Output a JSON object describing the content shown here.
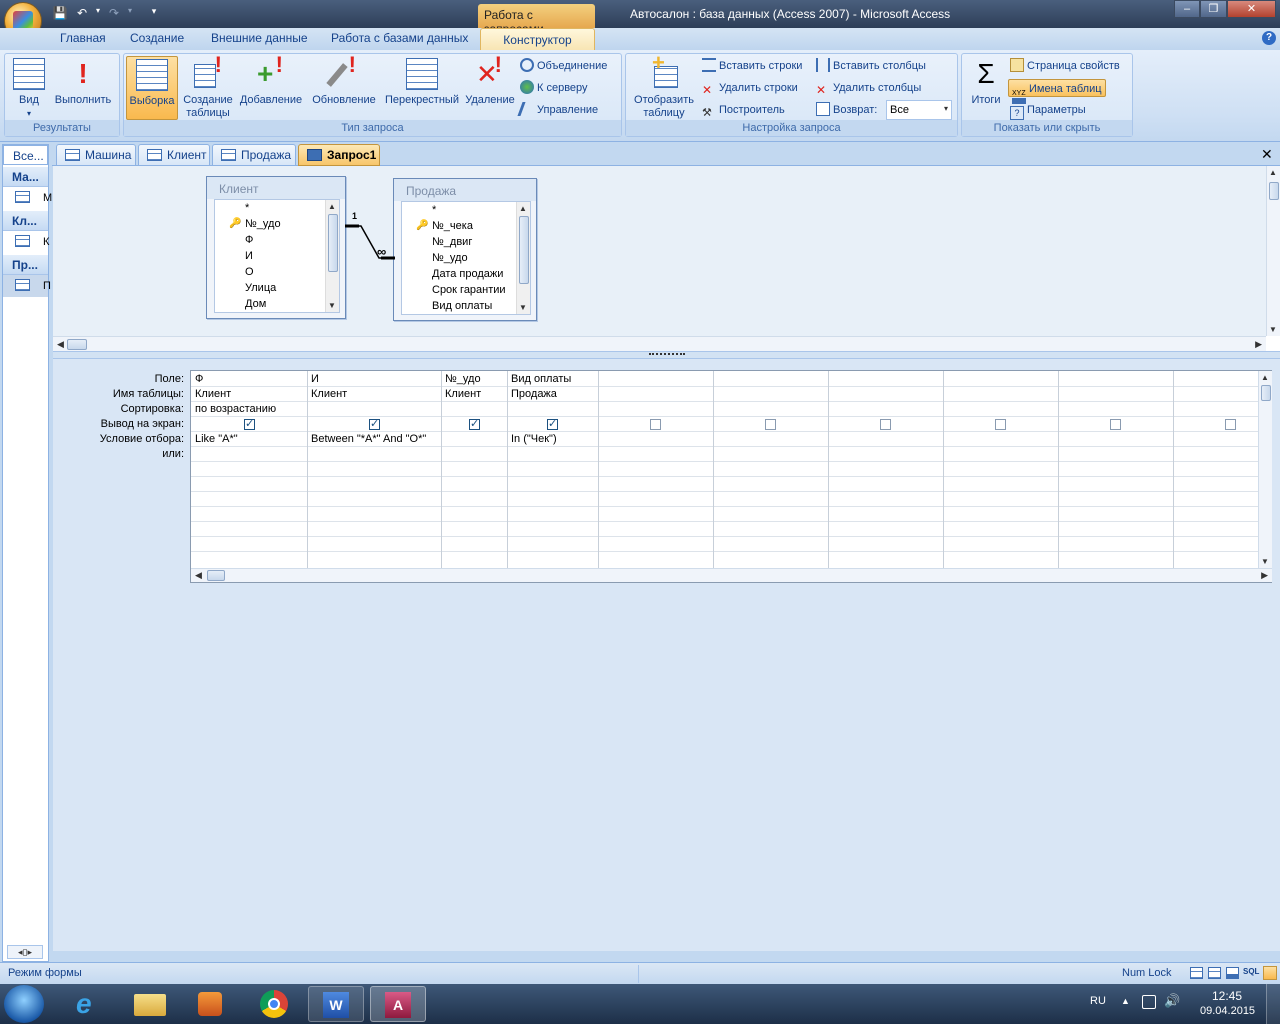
{
  "window": {
    "title": "Автосалон : база данных (Access 2007) - Microsoft Access",
    "context_tab_title": "Работа с запросами",
    "buttons": {
      "minimize": "–",
      "restore": "❐",
      "close": "✕"
    }
  },
  "ribbon_tabs": [
    "Главная",
    "Создание",
    "Внешние данные",
    "Работа с базами данных",
    "Конструктор"
  ],
  "ribbon": {
    "results": {
      "label": "Результаты",
      "view": "Вид",
      "run": "Выполнить"
    },
    "query_type": {
      "label": "Тип запроса",
      "select": "Выборка",
      "make_table_1": "Создание",
      "make_table_2": "таблицы",
      "append": "Добавление",
      "update": "Обновление",
      "crosstab": "Перекрестный",
      "delete": "Удаление",
      "union": "Объединение",
      "pass_through": "К серверу",
      "data_definition": "Управление"
    },
    "query_setup": {
      "label": "Настройка запроса",
      "show_table_1": "Отобразить",
      "show_table_2": "таблицу",
      "insert_rows": "Вставить строки",
      "delete_rows": "Удалить строки",
      "builder": "Построитель",
      "insert_columns": "Вставить столбцы",
      "delete_columns": "Удалить столбцы",
      "return_label": "Возврат:",
      "return_value": "Все"
    },
    "show_hide": {
      "label": "Показать или скрыть",
      "totals": "Итоги",
      "property_sheet": "Страница свойств",
      "table_names": "Имена таблиц",
      "parameters": "Параметры"
    }
  },
  "nav_pane": {
    "header": "Все...",
    "groups": [
      {
        "label": "Ма...",
        "item": "М"
      },
      {
        "label": "Кл...",
        "item": "К"
      },
      {
        "label": "Пр...",
        "item": "П"
      }
    ]
  },
  "doc_tabs": [
    "Машина",
    "Клиент",
    "Продажа",
    "Запрос1"
  ],
  "tables": [
    {
      "title": "Клиент",
      "fields": [
        "*",
        "№_удо",
        "Ф",
        "И",
        "О",
        "Улица",
        "Дом"
      ]
    },
    {
      "title": "Продажа",
      "fields": [
        "*",
        "№_чека",
        "№_двиг",
        "№_удо",
        "Дата продажи",
        "Срок гарантии",
        "Вид оплаты"
      ]
    }
  ],
  "relation": {
    "one": "1",
    "many": "∞"
  },
  "qbe_grid": {
    "row_labels": [
      "Поле:",
      "Имя таблицы:",
      "Сортировка:",
      "Вывод на экран:",
      "Условие отбора:",
      "или:"
    ],
    "columns": [
      {
        "field": "Ф",
        "table": "Клиент",
        "sort": "по возрастанию",
        "show": true,
        "criteria": "Like \"A*\""
      },
      {
        "field": "И",
        "table": "Клиент",
        "sort": "",
        "show": true,
        "criteria": "Between \"*A*\" And \"O*\""
      },
      {
        "field": "№_удо",
        "table": "Клиент",
        "sort": "",
        "show": true,
        "criteria": ""
      },
      {
        "field": "Вид оплаты",
        "table": "Продажа",
        "sort": "",
        "show": true,
        "criteria": "In (\"Чек\")"
      },
      {
        "field": "",
        "table": "",
        "sort": "",
        "show": false,
        "criteria": ""
      },
      {
        "field": "",
        "table": "",
        "sort": "",
        "show": false,
        "criteria": ""
      },
      {
        "field": "",
        "table": "",
        "sort": "",
        "show": false,
        "criteria": ""
      },
      {
        "field": "",
        "table": "",
        "sort": "",
        "show": false,
        "criteria": ""
      },
      {
        "field": "",
        "table": "",
        "sort": "",
        "show": false,
        "criteria": ""
      },
      {
        "field": "",
        "table": "",
        "sort": "",
        "show": false,
        "criteria": ""
      }
    ]
  },
  "status_bar": {
    "mode": "Режим формы",
    "num_lock": "Num Lock"
  },
  "taskbar": {
    "lang": "RU",
    "time": "12:45",
    "date": "09.04.2015"
  }
}
